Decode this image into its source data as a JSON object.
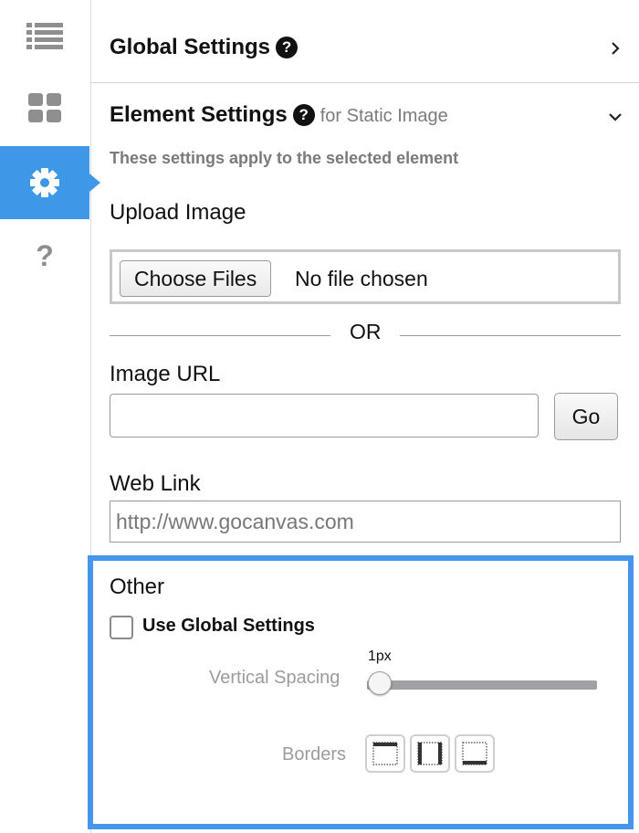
{
  "rail": {
    "items": [
      {
        "icon": "list-icon"
      },
      {
        "icon": "grid-icon"
      },
      {
        "icon": "gear-icon",
        "active": true
      },
      {
        "icon": "question-icon",
        "glyph": "?"
      }
    ]
  },
  "global_settings": {
    "title": "Global Settings",
    "help_glyph": "?"
  },
  "element_settings": {
    "title": "Element Settings",
    "help_glyph": "?",
    "for_label": "for Static Image",
    "note": "These settings apply to the selected element"
  },
  "upload": {
    "label": "Upload Image",
    "choose_button": "Choose Files",
    "status": "No file chosen"
  },
  "divider": {
    "or_text": "OR"
  },
  "image_url": {
    "label": "Image URL",
    "value": "",
    "go_button": "Go"
  },
  "web_link": {
    "label": "Web Link",
    "placeholder": "http://www.gocanvas.com"
  },
  "other": {
    "title": "Other",
    "use_global_label": "Use Global Settings",
    "use_global_checked": false,
    "vertical_spacing_label": "Vertical Spacing",
    "vertical_spacing_value": "1px",
    "borders_label": "Borders",
    "border_buttons": [
      "border-top-icon",
      "border-sides-icon",
      "border-bottom-icon"
    ]
  },
  "colors": {
    "accent": "#3f97e8",
    "highlight": "#4596ec"
  }
}
